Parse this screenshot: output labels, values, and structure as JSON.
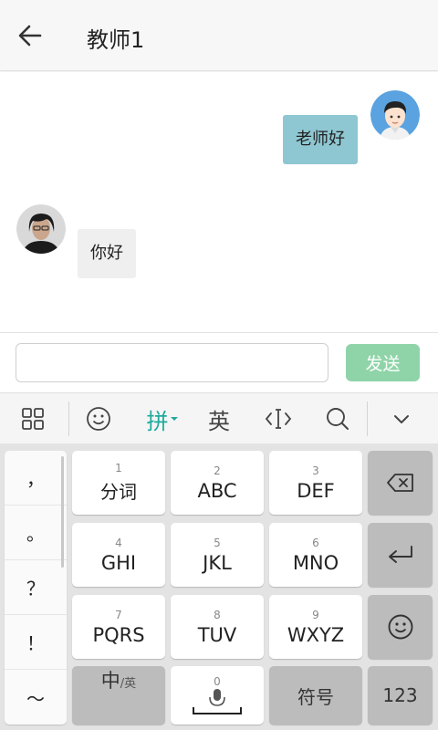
{
  "header": {
    "title": "教师1",
    "back_icon": "arrow-left-icon"
  },
  "chat": {
    "messages": [
      {
        "side": "right",
        "text": "老师好",
        "avatar": "user-avatar"
      },
      {
        "side": "left",
        "text": "你好",
        "avatar": "teacher-avatar"
      }
    ]
  },
  "input": {
    "value": "",
    "placeholder": "",
    "send_label": "发送"
  },
  "toolbar": {
    "icons": [
      "grid-icon",
      "emoji-icon",
      "text-cursor-icon",
      "search-icon",
      "chevron-down-icon"
    ],
    "pinyin_label": "拼",
    "english_label": "英"
  },
  "keyboard": {
    "punctuation": [
      "，",
      "。",
      "？",
      "！",
      "～"
    ],
    "keys": [
      {
        "num": "1",
        "label": "分词"
      },
      {
        "num": "2",
        "label": "ABC"
      },
      {
        "num": "3",
        "label": "DEF"
      },
      {
        "num": "4",
        "label": "GHI"
      },
      {
        "num": "5",
        "label": "JKL"
      },
      {
        "num": "6",
        "label": "MNO"
      },
      {
        "num": "7",
        "label": "PQRS"
      },
      {
        "num": "8",
        "label": "TUV"
      },
      {
        "num": "9",
        "label": "WXYZ"
      }
    ],
    "lang_switch": {
      "main": "中",
      "sub": "/英"
    },
    "space_num": "0",
    "symbols_label": "符号",
    "numbers_label": "123",
    "backspace_icon": "backspace-icon",
    "enter_icon": "enter-icon",
    "emoji_icon": "emoji-icon",
    "mic_icon": "microphone-icon"
  },
  "colors": {
    "accent": "#1faa9c",
    "send_button": "#8fd4a8",
    "my_bubble": "#8ec7d2",
    "other_bubble": "#efefef"
  }
}
